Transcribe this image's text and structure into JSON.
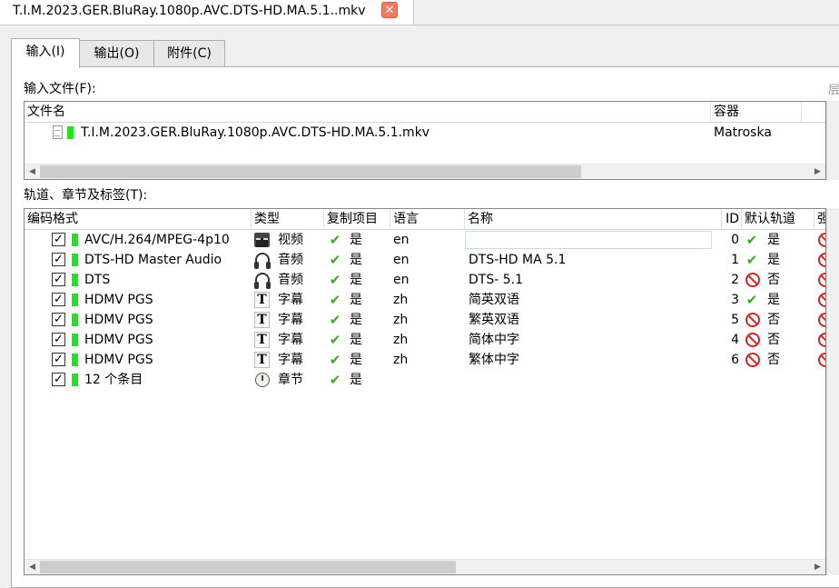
{
  "document_tab": {
    "title": "T.I.M.2023.GER.BluRay.1080p.AVC.DTS-HD.MA.5.1..mkv",
    "close_symbol": "✕"
  },
  "subtabs": [
    {
      "label": "输入(I)",
      "active": true
    },
    {
      "label": "输出(O)",
      "active": false
    },
    {
      "label": "附件(C)",
      "active": false
    }
  ],
  "input_files": {
    "label": "输入文件(F):",
    "columns": [
      "文件名",
      "容器"
    ],
    "rows": [
      {
        "filename": "T.I.M.2023.GER.BluRay.1080p.AVC.DTS-HD.MA.5.1.mkv",
        "container": "Matroska"
      }
    ],
    "right_cutoff": "层"
  },
  "tracks": {
    "label": "轨道、章节及标签(T):",
    "columns": [
      "编码格式",
      "类型",
      "复制项目",
      "语言",
      "名称",
      "ID",
      "默认轨道",
      "强"
    ],
    "rows": [
      {
        "codec": "AVC/H.264/MPEG-4p10",
        "type_icon": "video-icon",
        "type": "视频",
        "copy": "是",
        "lang": "en",
        "name": "",
        "id": "0",
        "default_ok": true,
        "default": "是"
      },
      {
        "codec": "DTS-HD Master Audio",
        "type_icon": "audio-icon",
        "type": "音频",
        "copy": "是",
        "lang": "en",
        "name": "DTS-HD MA 5.1",
        "id": "1",
        "default_ok": true,
        "default": "是"
      },
      {
        "codec": "DTS",
        "type_icon": "audio-icon",
        "type": "音频",
        "copy": "是",
        "lang": "en",
        "name": "DTS- 5.1",
        "id": "2",
        "default_ok": false,
        "default": "否"
      },
      {
        "codec": "HDMV PGS",
        "type_icon": "subtitle-icon",
        "type": "字幕",
        "copy": "是",
        "lang": "zh",
        "name": "简英双语",
        "id": "3",
        "default_ok": true,
        "default": "是"
      },
      {
        "codec": "HDMV PGS",
        "type_icon": "subtitle-icon",
        "type": "字幕",
        "copy": "是",
        "lang": "zh",
        "name": "繁英双语",
        "id": "5",
        "default_ok": false,
        "default": "否"
      },
      {
        "codec": "HDMV PGS",
        "type_icon": "subtitle-icon",
        "type": "字幕",
        "copy": "是",
        "lang": "zh",
        "name": "简体中字",
        "id": "4",
        "default_ok": false,
        "default": "否"
      },
      {
        "codec": "HDMV PGS",
        "type_icon": "subtitle-icon",
        "type": "字幕",
        "copy": "是",
        "lang": "zh",
        "name": "繁体中字",
        "id": "6",
        "default_ok": false,
        "default": "否"
      },
      {
        "codec": "12 个条目",
        "type_icon": "chapter-icon",
        "type": "章节",
        "copy": "是",
        "lang": "",
        "name": "",
        "id": "",
        "default_ok": null,
        "default": ""
      }
    ]
  },
  "colors": {
    "enabled_bar": "#1ee61e",
    "check_green": "#3ea62b",
    "forbid_red": "#d22323"
  }
}
